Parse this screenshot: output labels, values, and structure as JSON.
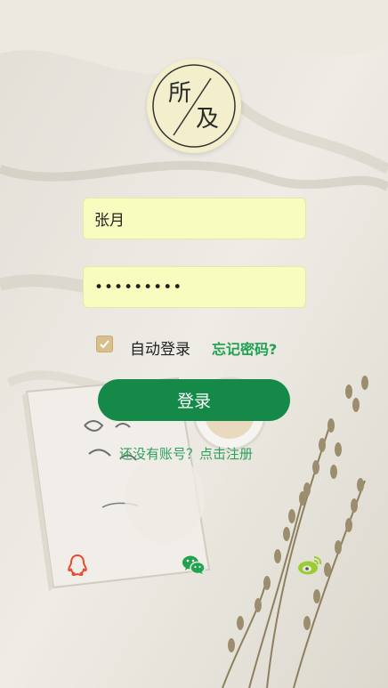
{
  "logo": {
    "char_top": "所",
    "char_bottom": "及"
  },
  "form": {
    "username_value": "张月",
    "password_value": "•••••••••",
    "auto_login_label": "自动登录",
    "auto_login_checked": true,
    "forgot_label": "忘记密码?",
    "login_button_label": "登录",
    "register_prompt": "还没有账号？点击注册"
  },
  "social": {
    "icons": [
      "qq-icon",
      "wechat-icon",
      "weibo-icon"
    ]
  },
  "colors": {
    "input_bg": "#f8fcbf",
    "button_green": "#158a48",
    "link_green": "#1fa14f",
    "checkbox_tan": "#d9bf8c",
    "logo_bg": "#f3efcc",
    "qq_red": "#e8492f",
    "wechat_green": "#21a34f",
    "weibo_yellowgreen": "#9acd32"
  }
}
